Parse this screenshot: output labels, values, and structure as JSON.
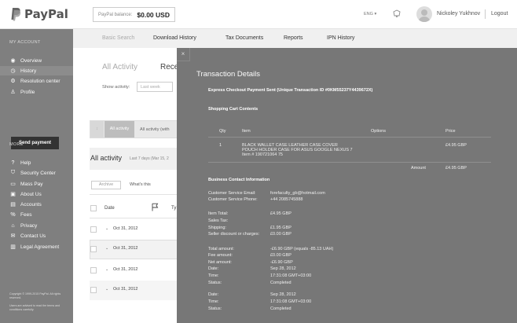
{
  "header": {
    "logo_text": "PayPal",
    "balance_label": "PayPal balance:",
    "balance_value": "$0.00 USD",
    "language": "ENG ▾",
    "user_name": "Nickoley Yukhnov",
    "logout": "Logout"
  },
  "sidebar": {
    "my_account_label": "MY ACCOUNT",
    "items": [
      {
        "label": "Overview",
        "icon": "eye-icon"
      },
      {
        "label": "History",
        "icon": "clock-icon"
      },
      {
        "label": "Resolution center",
        "icon": "gear-icon"
      },
      {
        "label": "Profile",
        "icon": "user-icon"
      }
    ],
    "send_payment": "Send payment",
    "more_label": "MORE",
    "more_items": [
      {
        "label": "Help",
        "icon": "question-icon"
      },
      {
        "label": "Security Center",
        "icon": "shield-icon"
      },
      {
        "label": "Mass Pay",
        "icon": "mass-pay-icon"
      },
      {
        "label": "About Us",
        "icon": "info-icon"
      },
      {
        "label": "Accounts",
        "icon": "accounts-icon"
      },
      {
        "label": "Fees",
        "icon": "percent-icon"
      },
      {
        "label": "Privacy",
        "icon": "lock-icon"
      },
      {
        "label": "Contact Us",
        "icon": "chat-icon"
      },
      {
        "label": "Legal Agreement",
        "icon": "document-icon"
      }
    ],
    "footnote1": "Copyright © 1999-2015 PayPal. All rights reserved.",
    "footnote2": "Users are advised to read the terms and conditions carefully."
  },
  "tabs": [
    "Basic Search",
    "Download History",
    "Tax Documents",
    "Reports",
    "IPN History"
  ],
  "main": {
    "all_activity_title": "All Activity",
    "recent_title": "Rece",
    "show_activity": "Show activity:",
    "last_week": "Last week",
    "chip1": "↕",
    "chip2": "All activity",
    "chip3": "All activity (with",
    "all_activity": "All activity",
    "date_range": "Last 7 days (Mar 15, 2",
    "archive": "Archive",
    "whats_this": "What's this",
    "col_date": "Date",
    "col_type": "Ty",
    "rows": [
      {
        "date": "Oct 31, 2012",
        "type": "Pa"
      },
      {
        "date": "Oct 31, 2012",
        "type": "Pa"
      },
      {
        "date": "Oct 31, 2012",
        "type": "Pa"
      },
      {
        "date": "Oct 31, 2012",
        "type": "Pa"
      }
    ]
  },
  "overlay": {
    "close": "×",
    "title": "Transaction Details",
    "express": "Express Checkout Payment Sent (Unique Transaction ID #0KM55237Y4439672X)",
    "cart_heading": "Shopping Cart Contents",
    "col_qty": "Qty",
    "col_item": "Item",
    "col_options": "Options",
    "col_price": "Price",
    "item_qty": "1",
    "item_line1": "BLACK WALLET CASE LEATHER CASE COVER",
    "item_line2": "POUCH HOLDER CASE FOR ASUS GOOGLE NEXUS 7",
    "item_line3": "Item # 190721064 75",
    "item_price": "£4.95 GBP",
    "amount_label": "Amount",
    "amount_value": "£4.95 GBP",
    "biz_heading": "Business Contact Information",
    "email_label": "Customer Service Email:",
    "email_value": "forefaculty_gb@hotmail.com",
    "phone_label": "Customer Service Phone:",
    "phone_value": "+44 2085745888",
    "item_total_label": "Item Total:",
    "item_total_value": "£4.95 GBP",
    "sales_tax_label": "Sales Tax:",
    "shipping_label": "Shipping:",
    "shipping_value": "£1.95 GBP",
    "discount_label": "Seller discount or charges:",
    "discount_value": "£0.00 GBP",
    "total_label": "Total amount:",
    "total_value": "-£6.90 GBP (equals -85.13 UAH)",
    "fee_label": "Fee amount:",
    "fee_value": "£0.00 GBP",
    "net_label": "Net amount:",
    "net_value": "-£6.90 GBP",
    "date_label": "Date:",
    "date_value": "Sep 28, 2012",
    "time_label": "Time:",
    "time_value": "17:31:08 GMT+03:00",
    "status_label": "Status:",
    "status_value": "Completed",
    "date2_label": "Date:",
    "date2_value": "Sep 28, 2012",
    "time2_label": "Time:",
    "time2_value": "17:31:08 GMT+03:00",
    "status2_label": "Status:",
    "status2_value": "Completed"
  },
  "colors": {
    "sidebar": "#7f7f7f",
    "overlay": "#777777",
    "tabbar": "#f0f0f0",
    "brand": "#555555"
  }
}
